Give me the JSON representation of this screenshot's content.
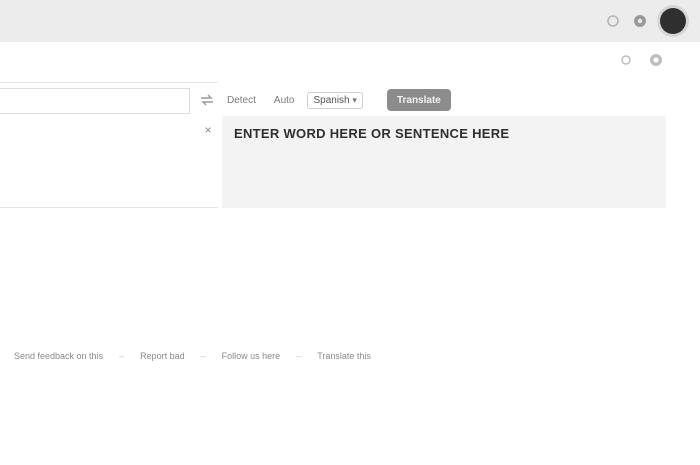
{
  "topbar": {
    "icons": [
      "apps-icon",
      "settings-icon",
      "account-avatar"
    ]
  },
  "toolbar": {
    "icons": [
      "history-icon",
      "saved-icon"
    ]
  },
  "source": {
    "value": "",
    "placeholder": ""
  },
  "languages": {
    "swap_icon": "swap-icon",
    "tabs": [
      "Detect",
      "Auto",
      "Spanish"
    ],
    "active_index": 2,
    "dropdown_glyph": "▾",
    "translate_label": "Translate"
  },
  "result": {
    "text": "ENTER WORD HERE OR SENTENCE HERE"
  },
  "footer": {
    "links": [
      "Send feedback on this",
      "Report bad",
      "Follow us here",
      "Translate this"
    ]
  }
}
